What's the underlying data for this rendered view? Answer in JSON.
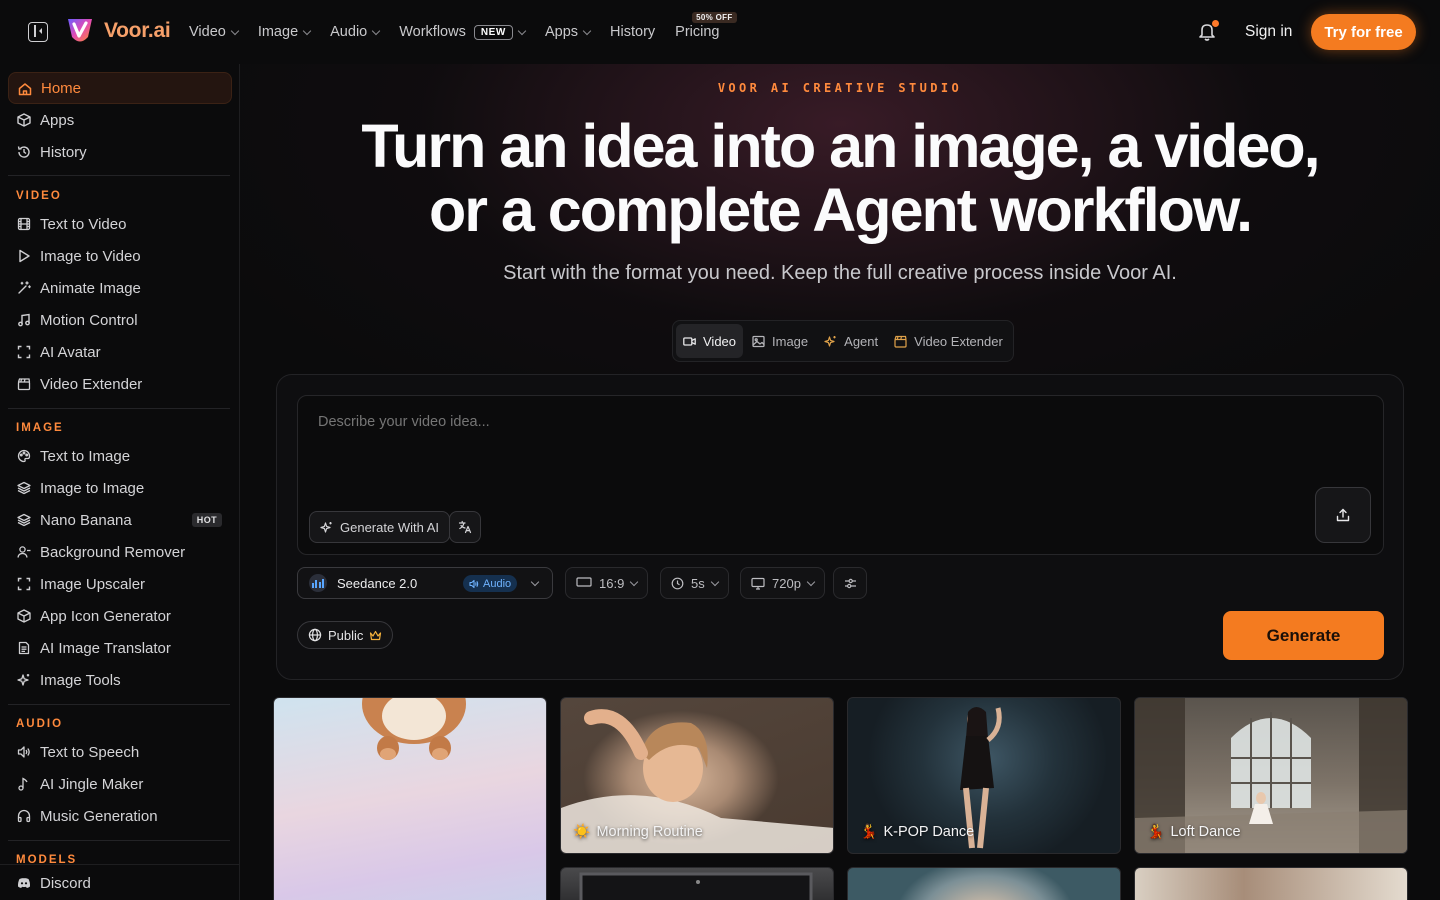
{
  "brand": {
    "name": "Voor.ai"
  },
  "nav": {
    "video": "Video",
    "image": "Image",
    "audio": "Audio",
    "workflows": "Workflows",
    "workflows_badge": "NEW",
    "apps": "Apps",
    "history": "History",
    "pricing": "Pricing",
    "pricing_badge": "50% OFF"
  },
  "header": {
    "signin": "Sign in",
    "try": "Try for free"
  },
  "sidebar": {
    "top": [
      "Home",
      "Apps",
      "History"
    ],
    "video_label": "VIDEO",
    "video": [
      "Text to Video",
      "Image to Video",
      "Animate Image",
      "Motion Control",
      "AI Avatar",
      "Video Extender"
    ],
    "image_label": "IMAGE",
    "image": [
      "Text to Image",
      "Image to Image",
      "Nano Banana",
      "Background Remover",
      "Image Upscaler",
      "App Icon Generator",
      "AI Image Translator",
      "Image Tools"
    ],
    "hot_badge": "HOT",
    "audio_label": "AUDIO",
    "audio": [
      "Text to Speech",
      "AI Jingle Maker",
      "Music Generation"
    ],
    "models_label": "MODELS",
    "discord": "Discord"
  },
  "hero": {
    "kicker": "VOOR AI CREATIVE STUDIO",
    "headline_1": "Turn an idea into an image, a video,",
    "headline_2": "or a complete Agent workflow.",
    "subhead": "Start with the format you need. Keep the full creative process inside Voor AI."
  },
  "modes": [
    "Video",
    "Image",
    "Agent",
    "Video Extender"
  ],
  "composer": {
    "placeholder": "Describe your video idea...",
    "generate_ai": "Generate With AI",
    "model": "Seedance 2.0",
    "audio": "Audio",
    "ratio": "16:9",
    "duration": "5s",
    "resolution": "720p",
    "visibility": "Public",
    "generate": "Generate"
  },
  "cards": [
    {
      "label": "",
      "emoji": ""
    },
    {
      "label": "Morning Routine",
      "emoji": "☀️"
    },
    {
      "label": "K-POP Dance",
      "emoji": "💃"
    },
    {
      "label": "Loft Dance",
      "emoji": "💃"
    }
  ],
  "colors": {
    "accent": "#f47b20",
    "accent_text": "#ff8a3d",
    "bg": "#0b0b0c"
  }
}
